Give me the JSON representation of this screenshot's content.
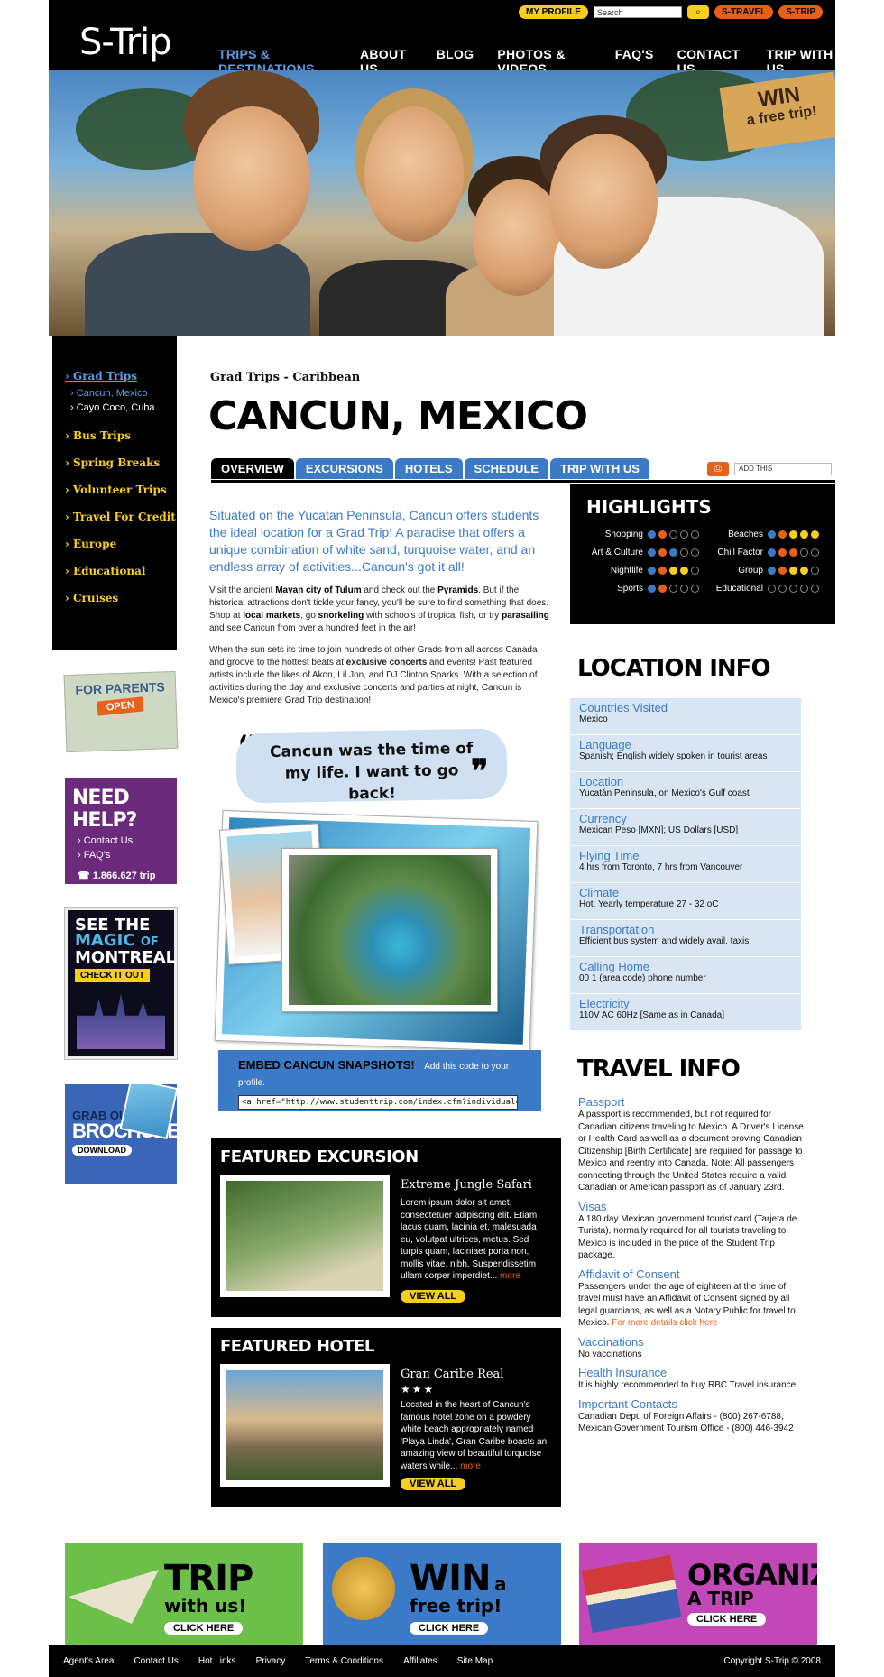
{
  "header": {
    "logo": "S-Trip",
    "my_profile": "MY PROFILE",
    "search_placeholder": "Search",
    "stravel": "S-TRAVEL",
    "strip": "S-TRIP",
    "nav": [
      "TRIPS & DESTINATIONS",
      "ABOUT US",
      "BLOG",
      "PHOTOS & VIDEOS",
      "FAQ'S",
      "CONTACT US",
      "TRIP WITH US"
    ]
  },
  "hero": {
    "win_line1": "WIN",
    "win_line2": "a free trip!"
  },
  "sidebar": {
    "grad_trips": "› Grad Trips",
    "sub_cancun": "› Cancun, Mexico",
    "sub_cayo": "› Cayo Coco, Cuba",
    "items": [
      "› Bus Trips",
      "› Spring Breaks",
      "› Volunteer Trips",
      "› Travel For Credit",
      "› Europe",
      "› Educational",
      "› Cruises"
    ]
  },
  "promos_side": {
    "parents": "FOR PARENTS",
    "open": "OPEN",
    "help_title": "NEED HELP?",
    "help_contact": "› Contact Us",
    "help_faq": "› FAQ's",
    "help_phone": "☎ 1.866.627 trip",
    "montreal_see": "SEE THE",
    "montreal_magic": "MAGIC",
    "montreal_of": "OF",
    "montreal_city": "MONTREAL",
    "montreal_cta": "CHECK IT OUT",
    "brochure_grab": "GRAB OUR",
    "brochure_big": "BROCHURE!",
    "brochure_dl": "DOWNLOAD"
  },
  "main": {
    "breadcrumb": "Grad Trips - Caribbean",
    "title": "CANCUN, MEXICO",
    "tabs": [
      "OVERVIEW",
      "EXCURSIONS",
      "HOTELS",
      "SCHEDULE",
      "TRIP WITH US"
    ],
    "addthis": "ADD THIS",
    "lead": "Situated on the Yucatan Peninsula, Cancun offers students the ideal location for a Grad Trip! A paradise that offers a unique combination of white sand, turquoise water, and an endless array of activities...Cancun's got it all!",
    "p1": {
      "a": "Visit the ancient ",
      "b": "Mayan city of Tulum",
      "c": " and check out the ",
      "d": "Pyramids",
      "e": ". But if the historical attractions don't tickle your fancy, you'll be sure to find something that does. Shop at ",
      "f": "local markets",
      "g": ", go ",
      "h": "snorkeling",
      "i": " with schools of tropical fish, or try ",
      "j": "parasailing",
      "k": " and see Cancun from over a hundred feet in the air!"
    },
    "p2": {
      "a": "When the sun sets its time to join hundreds of other Grads from all across Canada and groove to the hottest beats at ",
      "b": "exclusive concerts",
      "c": " and events! Past featured artists include the likes of Akon, Lil Jon, and DJ Clinton Sparks. With a selection of activities during the day and exclusive concerts and parties at night, Cancun is Mexico's premiere Grad Trip destination!"
    },
    "quote": "Cancun was the time of my life. I want to go back!",
    "embed_label": "EMBED CANCUN SNAPSHOTS!",
    "embed_hint": "Add this code to your profile.",
    "embed_code": "<a href=\"http://www.studenttrip.com/index.cfm?individualcfm"
  },
  "featured_excursion": {
    "heading": "FEATURED EXCURSION",
    "name": "Extreme Jungle Safari",
    "desc": "Lorem ipsum dolor sit amet, consectetuer adipiscing elit. Etiam lacus quam, lacinia et, malesuada eu, volutpat ultrices, metus. Sed turpis quam, laciniaet porta non, mollis vitae, nibh. Suspendissetim ullam corper imperdiet...",
    "more": "more",
    "view_all": "VIEW ALL"
  },
  "featured_hotel": {
    "heading": "FEATURED HOTEL",
    "name": "Gran Caribe Real",
    "stars": "★★★",
    "desc": "Located in the heart of Cancun's famous hotel zone on a powdery white beach appropriately named 'Playa Linda', Gran Caribe boasts an amazing view of beautiful turquoise waters while...",
    "more": "more",
    "view_all": "VIEW ALL"
  },
  "highlights": {
    "title": "HIGHLIGHTS",
    "rows": [
      {
        "label": "Shopping",
        "rating": 2,
        "color": "b"
      },
      {
        "label": "Beaches",
        "rating": 5,
        "color": "y"
      },
      {
        "label": "Art & Culture",
        "rating": 3,
        "color": "b"
      },
      {
        "label": "Chill Factor",
        "rating": 3,
        "color": "o"
      },
      {
        "label": "Nightlife",
        "rating": 4,
        "color": "y"
      },
      {
        "label": "Group",
        "rating": 4,
        "color": "y"
      },
      {
        "label": "Sports",
        "rating": 2,
        "color": "o"
      },
      {
        "label": "Educational",
        "rating": 0,
        "color": "b"
      }
    ]
  },
  "location_info": {
    "title": "LOCATION INFO",
    "items": [
      {
        "k": "Countries Visited",
        "v": "Mexico"
      },
      {
        "k": "Language",
        "v": "Spanish; English widely spoken in tourist areas"
      },
      {
        "k": "Location",
        "v": "Yucatán Peninsula, on Mexico's Gulf coast"
      },
      {
        "k": "Currency",
        "v": "Mexican Peso [MXN]; US Dollars [USD]"
      },
      {
        "k": "Flying Time",
        "v": "4 hrs from Toronto, 7 hrs from Vancouver"
      },
      {
        "k": "Climate",
        "v": "Hot. Yearly temperature 27 - 32 oC"
      },
      {
        "k": "Transportation",
        "v": "Efficient bus system and widely avail. taxis."
      },
      {
        "k": "Calling Home",
        "v": "00 1 (area code) phone number"
      },
      {
        "k": "Electricity",
        "v": "110V AC 60Hz [Same as in Canada]"
      }
    ]
  },
  "travel_info": {
    "title": "TRAVEL INFO",
    "passport_k": "Passport",
    "passport_v": "A passport is recommended, but not required for Canadian citizens traveling to Mexico. A Driver's License or Health Card as well as a document proving Canadian Citizenship [Birth Certificate] are required for passage to Mexico and reentry into Canada. Note: All passengers connecting through the United States require a valid Canadian or American passport as of January 23rd.",
    "visas_k": "Visas",
    "visas_v": "A 180 day Mexican government tourist card (Tarjeta de Turista), normally required for all tourists traveling to Mexico is included in the price of the Student Trip package.",
    "affidavit_k": "Affidavit of Consent",
    "affidavit_v": "Passengers under the age of eighteen at the time of travel must have an Affidavit of Consent signed by all legal guardians, as well as a Notary Public for travel to Mexico.",
    "affidavit_link": "For more details click here",
    "vacc_k": "Vaccinations",
    "vacc_v": "No vaccinations",
    "health_k": "Health Insurance",
    "health_v": "It is highly recommended to buy RBC Travel insurance.",
    "contacts_k": "Important Contacts",
    "contacts_v1": "Canadian Dept. of Foreign Affairs - (800) 267-6788,",
    "contacts_v2": "Mexican Government Tourism Office - (800) 446-3942"
  },
  "bottom_promos": {
    "trip_big": "TRIP",
    "trip_sm": "with us!",
    "win_big": "WIN",
    "win_sm": "a free trip!",
    "org_big": "ORGANIZE",
    "org_sm": "A TRIP",
    "click": "CLICK HERE"
  },
  "footer": {
    "links": [
      "Agent's Area",
      "Contact Us",
      "Hot Links",
      "Privacy",
      "Terms & Conditions",
      "Affiliates",
      "Site Map"
    ],
    "copyright": "Copyright S-Trip © 2008"
  },
  "colors": {
    "accent_blue": "#3a7ac6",
    "accent_yellow": "#f6cf1c",
    "accent_orange": "#e8611a",
    "purple": "#6c2a7c"
  }
}
